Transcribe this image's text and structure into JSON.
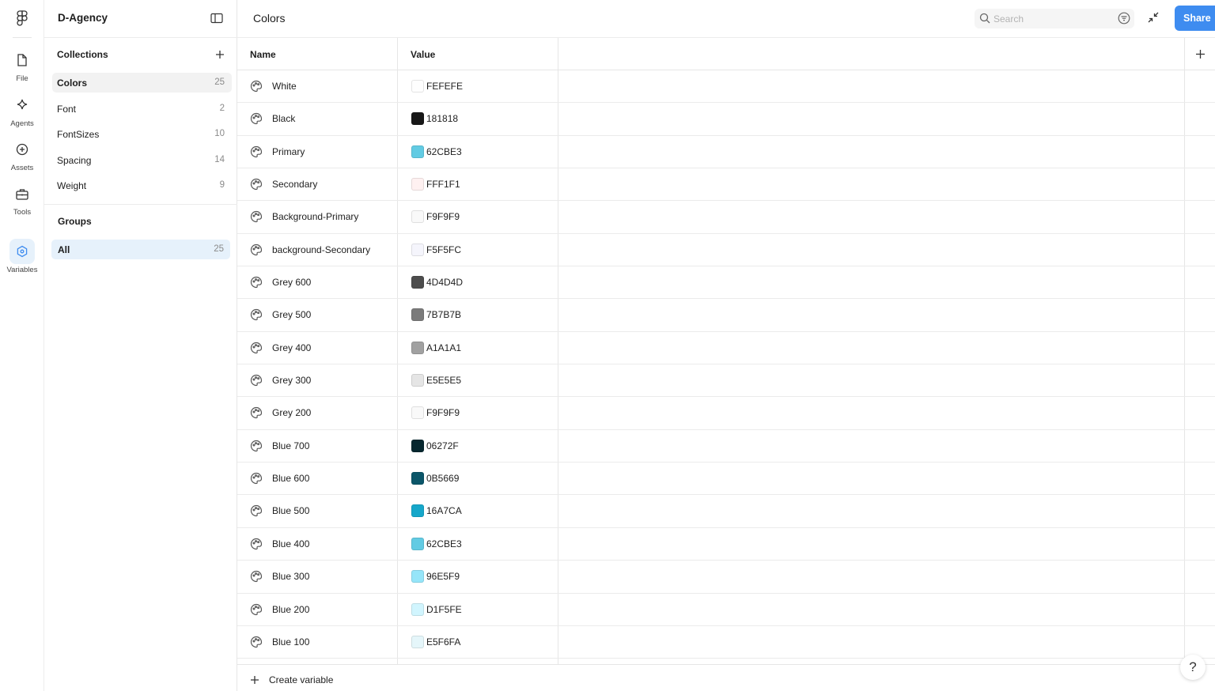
{
  "rail": {
    "items": [
      {
        "label": "File",
        "icon": "file-icon"
      },
      {
        "label": "Agents",
        "icon": "sparkle-icon"
      },
      {
        "label": "Assets",
        "icon": "plus-circle-icon"
      },
      {
        "label": "Tools",
        "icon": "toolbox-icon"
      },
      {
        "label": "Variables",
        "icon": "variables-icon"
      }
    ]
  },
  "panel": {
    "project_title": "D-Agency",
    "collections_title": "Collections",
    "collections": [
      {
        "label": "Colors",
        "count": "25"
      },
      {
        "label": "Font",
        "count": "2"
      },
      {
        "label": "FontSizes",
        "count": "10"
      },
      {
        "label": "Spacing",
        "count": "14"
      },
      {
        "label": "Weight",
        "count": "9"
      }
    ],
    "groups_title": "Groups",
    "groups": [
      {
        "label": "All",
        "count": "25"
      }
    ]
  },
  "header": {
    "title": "Colors",
    "search_placeholder": "Search",
    "share_label": "Share"
  },
  "table": {
    "col_name": "Name",
    "col_value": "Value",
    "rows": [
      {
        "name": "White",
        "value": "FEFEFE",
        "color": "#FEFEFE"
      },
      {
        "name": "Black",
        "value": "181818",
        "color": "#181818"
      },
      {
        "name": "Primary",
        "value": "62CBE3",
        "color": "#62CBE3"
      },
      {
        "name": "Secondary",
        "value": "FFF1F1",
        "color": "#FFF1F1"
      },
      {
        "name": "Background-Primary",
        "value": "F9F9F9",
        "color": "#F9F9F9"
      },
      {
        "name": "background-Secondary",
        "value": "F5F5FC",
        "color": "#F5F5FC"
      },
      {
        "name": "Grey 600",
        "value": "4D4D4D",
        "color": "#4D4D4D"
      },
      {
        "name": "Grey 500",
        "value": "7B7B7B",
        "color": "#7B7B7B"
      },
      {
        "name": "Grey 400",
        "value": "A1A1A1",
        "color": "#A1A1A1"
      },
      {
        "name": "Grey 300",
        "value": "E5E5E5",
        "color": "#E5E5E5"
      },
      {
        "name": "Grey 200",
        "value": "F9F9F9",
        "color": "#F9F9F9"
      },
      {
        "name": "Blue 700",
        "value": "06272F",
        "color": "#06272F"
      },
      {
        "name": "Blue 600",
        "value": "0B5669",
        "color": "#0B5669"
      },
      {
        "name": "Blue 500",
        "value": "16A7CA",
        "color": "#16A7CA"
      },
      {
        "name": "Blue 400",
        "value": "62CBE3",
        "color": "#62CBE3"
      },
      {
        "name": "Blue 300",
        "value": "96E5F9",
        "color": "#96E5F9"
      },
      {
        "name": "Blue 200",
        "value": "D1F5FE",
        "color": "#D1F5FE"
      },
      {
        "name": "Blue 100",
        "value": "E5F6FA",
        "color": "#E5F6FA"
      }
    ],
    "create_label": "Create variable"
  },
  "help_label": "?",
  "accent": "#3E8CF0"
}
